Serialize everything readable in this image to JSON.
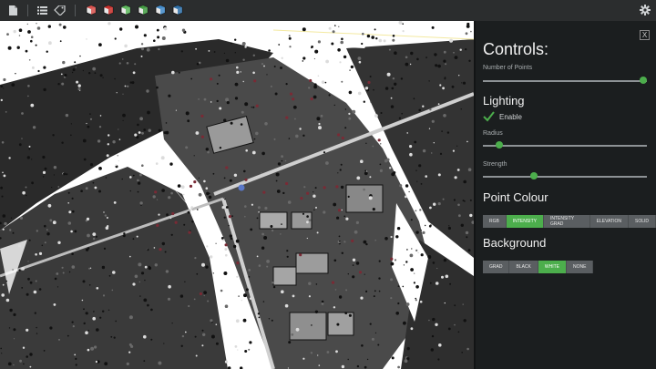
{
  "toolbar": {
    "buttons": [
      {
        "name": "document-icon"
      },
      {
        "name": "list-icon"
      },
      {
        "name": "tag-icon"
      },
      {
        "name": "cube-red-icon",
        "color": "#d9534f"
      },
      {
        "name": "cube-red-green-icon",
        "color": "#c9302c"
      },
      {
        "name": "cube-green-icon",
        "color": "#5cb85c"
      },
      {
        "name": "cube-green-blue-icon",
        "color": "#449d44"
      },
      {
        "name": "cube-blue-icon",
        "color": "#428bca"
      },
      {
        "name": "cube-blue-white-icon",
        "color": "#3071a9"
      },
      {
        "name": "gear-icon"
      }
    ]
  },
  "viewport": {
    "description": "3D point cloud view"
  },
  "controls": {
    "title": "Controls:",
    "close_label": "X",
    "number_of_points_label": "Number of Points",
    "number_of_points_value": 0.98,
    "lighting": {
      "heading": "Lighting",
      "enable_label": "Enable",
      "enabled": true,
      "radius_label": "Radius",
      "radius_value": 0.1,
      "strength_label": "Strength",
      "strength_value": 0.31
    },
    "point_colour": {
      "heading": "Point Colour",
      "options": [
        "RGB",
        "INTENSITY",
        "INTENSITY GRAD",
        "ELEVATION",
        "SOLID"
      ],
      "selected": "INTENSITY"
    },
    "background": {
      "heading": "Background",
      "options": [
        "GRAD",
        "BLACK",
        "WHITE",
        "NONE"
      ],
      "selected": "WHITE"
    },
    "accent_color": "#4cae4c"
  }
}
